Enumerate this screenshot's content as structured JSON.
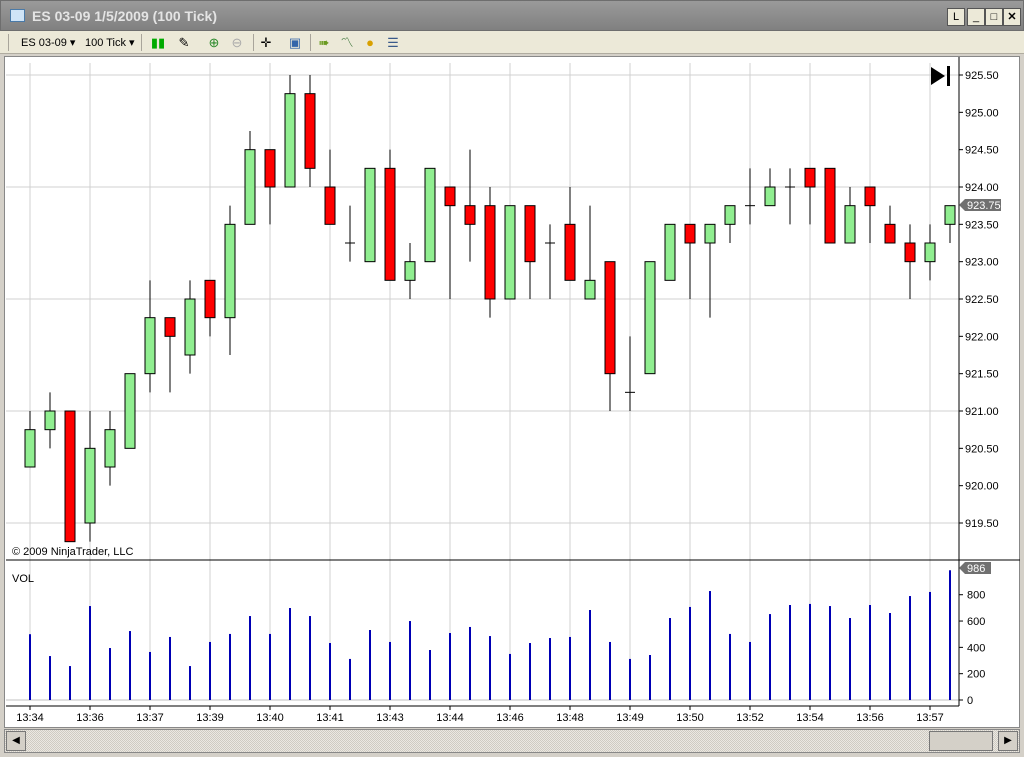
{
  "window": {
    "title": "ES 03-09  1/5/2009 (100 Tick)",
    "layout_btn": "L"
  },
  "toolbar": {
    "instrument": "ES 03-09",
    "interval": "100 Tick"
  },
  "chart": {
    "copyright": "© 2009 NinjaTrader, LLC",
    "volume_label": "VOL",
    "last_price_label": "923.75",
    "last_volume_label": "986",
    "colors": {
      "up": "#90ee90",
      "down": "#ff0000",
      "volume": "#0000b4",
      "grid": "#d0d0d0"
    }
  },
  "chart_data": {
    "type": "candlestick",
    "price_axis": {
      "range": [
        919.25,
        925.5
      ],
      "ticks": [
        "919.50",
        "920.00",
        "920.50",
        "921.00",
        "921.50",
        "922.00",
        "922.50",
        "923.00",
        "923.50",
        "924.00",
        "924.50",
        "925.00",
        "925.50"
      ]
    },
    "volume_axis": {
      "range": [
        0,
        1000
      ],
      "ticks": [
        "0",
        "200",
        "400",
        "600",
        "800"
      ]
    },
    "x_labels": [
      {
        "bar": 0,
        "label": "13:34"
      },
      {
        "bar": 3,
        "label": "13:36"
      },
      {
        "bar": 6,
        "label": "13:37"
      },
      {
        "bar": 9,
        "label": "13:39"
      },
      {
        "bar": 12,
        "label": "13:40"
      },
      {
        "bar": 15,
        "label": "13:41"
      },
      {
        "bar": 18,
        "label": "13:43"
      },
      {
        "bar": 21,
        "label": "13:44"
      },
      {
        "bar": 24,
        "label": "13:46"
      },
      {
        "bar": 27,
        "label": "13:48"
      },
      {
        "bar": 30,
        "label": "13:49"
      },
      {
        "bar": 33,
        "label": "13:50"
      },
      {
        "bar": 36,
        "label": "13:52"
      },
      {
        "bar": 39,
        "label": "13:54"
      },
      {
        "bar": 42,
        "label": "13:56"
      },
      {
        "bar": 45,
        "label": "13:57"
      }
    ],
    "ohlc": [
      [
        920.25,
        921,
        920.25,
        920.75
      ],
      [
        920.75,
        921.25,
        920.5,
        921
      ],
      [
        921,
        921,
        919.25,
        919.25
      ],
      [
        919.5,
        921,
        919.25,
        920.5
      ],
      [
        920.25,
        921,
        920,
        920.75
      ],
      [
        920.5,
        921.5,
        920.5,
        921.5
      ],
      [
        921.5,
        922.75,
        921.25,
        922.25
      ],
      [
        922.25,
        922.25,
        921.25,
        922
      ],
      [
        921.75,
        922.75,
        921.5,
        922.5
      ],
      [
        922.75,
        922.75,
        922,
        922.25
      ],
      [
        922.25,
        923.75,
        921.75,
        923.5
      ],
      [
        923.5,
        924.75,
        923.5,
        924.5
      ],
      [
        924.5,
        924.5,
        923.5,
        924
      ],
      [
        924,
        925.5,
        924,
        925.25
      ],
      [
        925.25,
        925.5,
        924,
        924.25
      ],
      [
        924,
        924.5,
        923.5,
        923.5
      ],
      [
        923.25,
        923.75,
        923,
        923.25
      ],
      [
        923,
        924.25,
        923,
        924.25
      ],
      [
        924.25,
        924.5,
        922.75,
        922.75
      ],
      [
        922.75,
        923.25,
        922.5,
        923
      ],
      [
        923,
        924.25,
        923,
        924.25
      ],
      [
        924,
        924,
        922.5,
        923.75
      ],
      [
        923.75,
        924.5,
        923,
        923.5
      ],
      [
        923.75,
        924,
        922.25,
        922.5
      ],
      [
        922.5,
        923.75,
        922.5,
        923.75
      ],
      [
        923.75,
        923.75,
        922.5,
        923
      ],
      [
        923.25,
        923.5,
        922.5,
        923.25
      ],
      [
        923.5,
        924,
        922.75,
        922.75
      ],
      [
        922.5,
        923.75,
        922.5,
        922.75
      ],
      [
        923,
        923,
        921,
        921.5
      ],
      [
        921.25,
        922,
        921,
        921.25
      ],
      [
        921.5,
        923,
        921.5,
        923
      ],
      [
        922.75,
        923.5,
        922.75,
        923.5
      ],
      [
        923.5,
        923.5,
        922.5,
        923.25
      ],
      [
        923.25,
        923.5,
        922.25,
        923.5
      ],
      [
        923.5,
        923.75,
        923.25,
        923.75
      ],
      [
        923.75,
        924.25,
        923.5,
        923.75
      ],
      [
        923.75,
        924.25,
        923.75,
        924
      ],
      [
        924,
        924.25,
        923.5,
        924
      ],
      [
        924.25,
        924.25,
        923.5,
        924
      ],
      [
        924.25,
        924.25,
        923.25,
        923.25
      ],
      [
        923.25,
        924,
        923.25,
        923.75
      ],
      [
        924,
        924,
        923.25,
        923.75
      ],
      [
        923.5,
        923.75,
        923.25,
        923.25
      ],
      [
        923.25,
        923.5,
        922.5,
        923
      ],
      [
        923,
        923.5,
        922.75,
        923.25
      ],
      [
        923.5,
        923.75,
        923.25,
        923.75
      ]
    ],
    "volume": [
      500,
      334,
      258,
      714,
      395,
      524,
      365,
      479,
      258,
      441,
      502,
      638,
      502,
      699,
      638,
      433,
      312,
      532,
      441,
      600,
      380,
      509,
      555,
      486,
      350,
      433,
      471,
      479,
      684,
      441,
      312,
      342,
      623,
      707,
      828,
      502,
      441,
      653,
      722,
      730,
      714,
      623,
      722,
      661,
      790,
      821,
      986
    ]
  }
}
